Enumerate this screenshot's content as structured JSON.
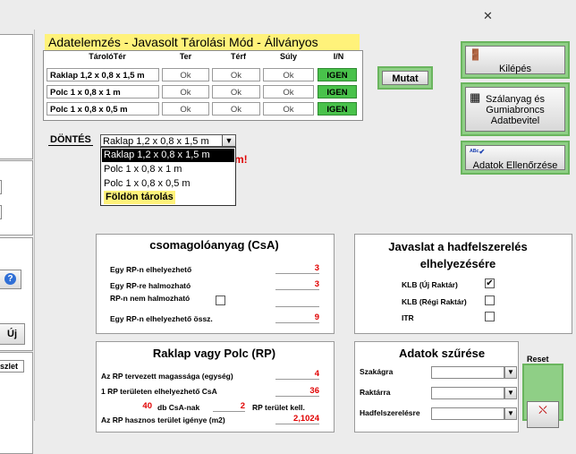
{
  "window": {
    "close_glyph": "✕"
  },
  "title": "Adatelemzés - Javasolt Tárolási Mód  - Állványos",
  "grid": {
    "headers": [
      "TárolóTér",
      "Ter",
      "Térf",
      "Súly",
      "I/N"
    ],
    "rows": [
      {
        "name": "Raklap 1,2 x 0,8 x 1,5 m",
        "ter": "Ok",
        "terf": "Ok",
        "suly": "Ok",
        "in": "IGEN"
      },
      {
        "name": "Polc 1 x 0,8 x 1 m",
        "ter": "Ok",
        "terf": "Ok",
        "suly": "Ok",
        "in": "IGEN"
      },
      {
        "name": "Polc 1 x 0,8 x 0,5 m",
        "ter": "Ok",
        "terf": "Ok",
        "suly": "Ok",
        "in": "IGEN"
      }
    ]
  },
  "buttons": {
    "mutat": "Mutat",
    "kilepes": "Kilépés",
    "szalanyag_l1": "Szálanyag és",
    "szalanyag_l2": "Gumiabroncs",
    "szalanyag_l3": "Adatbevitel",
    "adatok": "Adatok Ellenőrzése",
    "uj": "Új",
    "help": "?"
  },
  "dontes": {
    "label": "DÖNTÉS",
    "value": "Raklap 1,2 x 0,8 x 1,5 m",
    "options": [
      "Raklap 1,2 x 0,8 x 1,5 m",
      "Polc 1 x 0,8 x 1 m",
      "Polc 1 x 0,8 x 0,5 m",
      "Földön tárolás"
    ],
    "partial_text": "m!"
  },
  "csa": {
    "title": "csomagolóanyag (CsA)",
    "rows": [
      {
        "label": "Egy RP-n elhelyezhető",
        "value": "3"
      },
      {
        "label": "Egy RP-re halmozható",
        "value": "3"
      },
      {
        "label": "RP-n nem halmozható",
        "value": ""
      },
      {
        "label": "Egy RP-n elhelyezhető össz.",
        "value": "9"
      }
    ]
  },
  "javaslat": {
    "title_l1": "Javaslat a hadfelszerelés",
    "title_l2": "elhelyezésére",
    "items": [
      {
        "label": "KLB (Új Raktár)",
        "checked": true,
        "mark": "✔"
      },
      {
        "label": "KLB (Régi Raktár)",
        "checked": false,
        "mark": ""
      },
      {
        "label": "ITR",
        "checked": false,
        "mark": ""
      }
    ]
  },
  "rp": {
    "title": "Raklap vagy Polc (RP)",
    "r1_label": "Az RP tervezett magassága (egység)",
    "r1_value": "4",
    "r2_label": "1 RP területen elhelyezhető CsA",
    "r2_value": "36",
    "r3_num": "40",
    "r3_label": "db CsA-nak",
    "r3_num2": "2",
    "r3_label2": "RP terület kell.",
    "r4_label": "Az RP hasznos terület igénye (m2)",
    "r4_value": "2,1024"
  },
  "szures": {
    "title": "Adatok szűrése",
    "reset": "Reset",
    "fields": [
      "Szakágra",
      "Raktárra",
      "Hadfelszerelésre"
    ]
  },
  "left_partial": "szlet"
}
